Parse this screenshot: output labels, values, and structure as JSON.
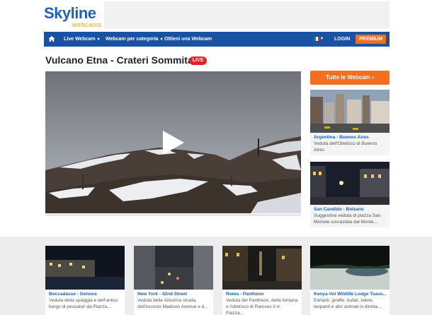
{
  "logo": {
    "main": "Skyline",
    "sub": "webcams"
  },
  "nav": {
    "items": [
      "Live Webcam",
      "Webcam per categoria",
      "Ottieni una Webcam"
    ],
    "login": "LOGIN",
    "premium": "PREMIUM",
    "home_icon": "home-icon",
    "flag_colors": [
      "#009246",
      "#ffffff",
      "#ce2b37"
    ]
  },
  "page": {
    "title": "Vulcano Etna - Crateri Sommitali",
    "live_badge": "LIVE"
  },
  "sidebar": {
    "button": "Tutte le Webcam ›",
    "cards": [
      {
        "title": "Argentina - Buenos Aires",
        "desc": "Veduta dell'Obelisco di Buenos Aires"
      },
      {
        "title": "San Candido - Bolzano",
        "desc": "Suggestiva veduta di piazza San Michele sovrastata dal Monte..."
      }
    ]
  },
  "bottom": {
    "cards": [
      {
        "title": "Boccadasse - Genova",
        "desc": "Veduta della spiaggia e dell'antico borgo di pescatori da Piazza..."
      },
      {
        "title": "New York - 42nd Street",
        "desc": "Veduta della 42esima strada, dell'incrocio Madison Avenue e d..."
      },
      {
        "title": "Roma - Pantheon",
        "desc": "Veduta del Pantheon, della fontana e l'obelisco di Ramses II in Piazza..."
      },
      {
        "title": "Kenya-Voi Wildlife Lodge Tsavo...",
        "desc": "Elefanti, giraffe, bufali, zebre, leopardi e altri animali in diretta..."
      }
    ]
  },
  "colors": {
    "brand_blue": "#1a52a3",
    "accent_orange": "#f36f21",
    "live_red": "#e32127"
  }
}
